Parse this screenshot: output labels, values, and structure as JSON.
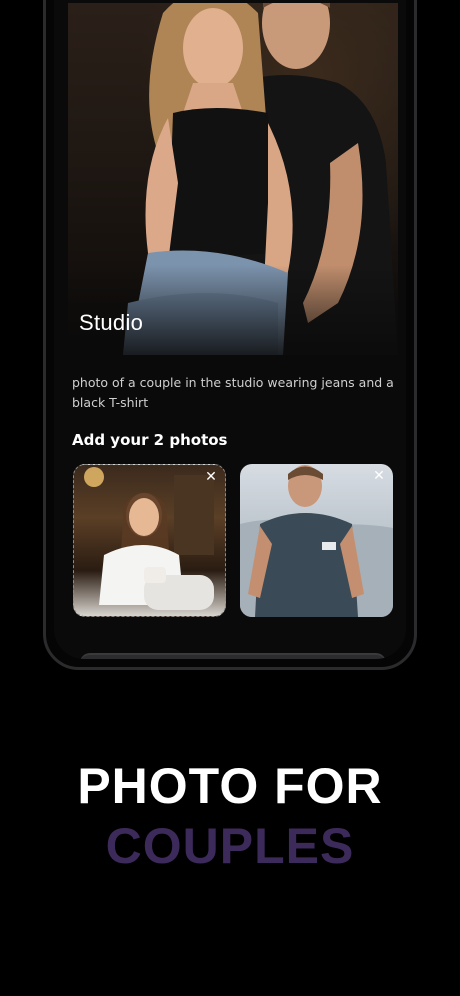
{
  "style": {
    "card_title": "Studio",
    "description": "photo of a couple in the studio wearing jeans and a black T-shirt"
  },
  "upload": {
    "title": "Add your 2 photos",
    "photos": [
      {
        "remove_icon": "close-icon"
      },
      {
        "remove_icon": "close-icon"
      }
    ]
  },
  "promo": {
    "line1": "PHOTO FOR",
    "line2": "COUPLES",
    "line1_color": "#ffffff",
    "line2_color": "#3c2a5a"
  }
}
